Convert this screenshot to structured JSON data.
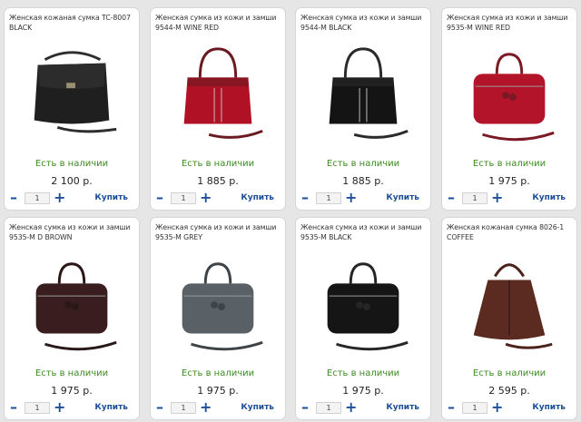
{
  "products": [
    {
      "title": "Женская кожаная сумка TC-8007\nBLACK",
      "status": "Есть в наличии",
      "price": "2 100 р.",
      "qty": "1",
      "buy": "Купить",
      "minus": "–",
      "plus": "+",
      "image": "crossbody-bag",
      "color": "#1f1f1f",
      "strap": "#2e2e2e"
    },
    {
      "title": "Женская сумка из кожи и замши\n9544-M WINE RED",
      "status": "Есть в наличии",
      "price": "1 885 р.",
      "qty": "1",
      "buy": "Купить",
      "minus": "–",
      "plus": "+",
      "image": "handbag",
      "color": "#b01124",
      "strap": "#6b1a22"
    },
    {
      "title": "Женская сумка из кожи и замши\n9544-M BLACK",
      "status": "Есть в наличии",
      "price": "1 885 р.",
      "qty": "1",
      "buy": "Купить",
      "minus": "–",
      "plus": "+",
      "image": "handbag",
      "color": "#141414",
      "strap": "#2a2a2a"
    },
    {
      "title": "Женская сумка из кожи и замши\n9535-M WINE RED",
      "status": "Есть в наличии",
      "price": "1 975 р.",
      "qty": "1",
      "buy": "Купить",
      "minus": "–",
      "plus": "+",
      "image": "box-bag",
      "color": "#b3142a",
      "strap": "#7a1a24"
    },
    {
      "title": "Женская сумка из кожи и замши\n9535-M D BROWN",
      "status": "Есть в наличии",
      "price": "1 975 р.",
      "qty": "1",
      "buy": "Купить",
      "minus": "–",
      "plus": "+",
      "image": "box-bag",
      "color": "#3a1d1f",
      "strap": "#2a1718"
    },
    {
      "title": "Женская сумка из кожи и замши\n9535-M GREY",
      "status": "Есть в наличии",
      "price": "1 975 р.",
      "qty": "1",
      "buy": "Купить",
      "minus": "–",
      "plus": "+",
      "image": "box-bag",
      "color": "#5a6166",
      "strap": "#3d4346"
    },
    {
      "title": "Женская сумка из кожи и замши\n9535-M BLACK",
      "status": "Есть в наличии",
      "price": "1 975 р.",
      "qty": "1",
      "buy": "Купить",
      "minus": "–",
      "plus": "+",
      "image": "box-bag",
      "color": "#151515",
      "strap": "#262626"
    },
    {
      "title": "Женская кожаная сумка 8026-1\nCOFFEE",
      "status": "Есть в наличии",
      "price": "2 595 р.",
      "qty": "1",
      "buy": "Купить",
      "minus": "–",
      "plus": "+",
      "image": "hobo-bag",
      "color": "#5b2a20",
      "strap": "#4a221a"
    }
  ]
}
